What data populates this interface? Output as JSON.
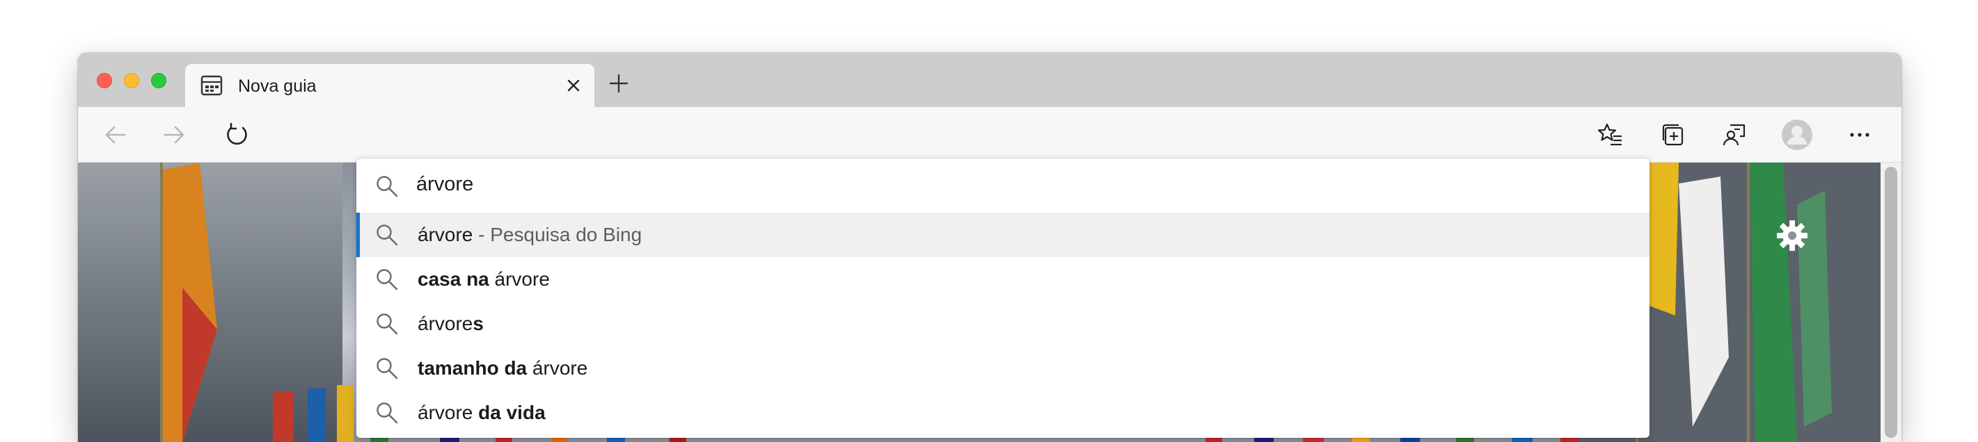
{
  "tab": {
    "title": "Nova guia",
    "favicon": "new-tab-page-icon",
    "close_icon": "close-icon"
  },
  "toolbar": {
    "back_icon": "arrow-left-icon",
    "forward_icon": "arrow-right-icon",
    "refresh_icon": "refresh-icon",
    "favorites_icon": "favorites-list-icon",
    "collections_icon": "collections-icon",
    "feedback_icon": "feedback-icon",
    "profile_icon": "profile-avatar-icon",
    "more_icon": "more-horizontal-icon"
  },
  "omnibox": {
    "value": "árvore",
    "suggestions": [
      {
        "parts": [
          {
            "t": "árvore",
            "s": "n"
          },
          {
            "t": " - Pesquisa do Bing",
            "s": "m"
          }
        ],
        "selected": true
      },
      {
        "parts": [
          {
            "t": "casa na",
            "s": "b"
          },
          {
            "t": " árvore",
            "s": "n"
          }
        ],
        "selected": false
      },
      {
        "parts": [
          {
            "t": "árvore",
            "s": "n"
          },
          {
            "t": "s",
            "s": "b"
          }
        ],
        "selected": false
      },
      {
        "parts": [
          {
            "t": "tamanho da",
            "s": "b"
          },
          {
            "t": " árvore",
            "s": "n"
          }
        ],
        "selected": false
      },
      {
        "parts": [
          {
            "t": "árvore",
            "s": "n"
          },
          {
            "t": " da vida",
            "s": "b"
          }
        ],
        "selected": false
      }
    ]
  },
  "content": {
    "background": "flags-in-snow-photo",
    "settings_icon": "gear-icon"
  },
  "colors": {
    "accent": "#1a6fd6",
    "traffic_close": "#fe5f57",
    "traffic_min": "#febc2e",
    "traffic_max": "#28c840"
  }
}
